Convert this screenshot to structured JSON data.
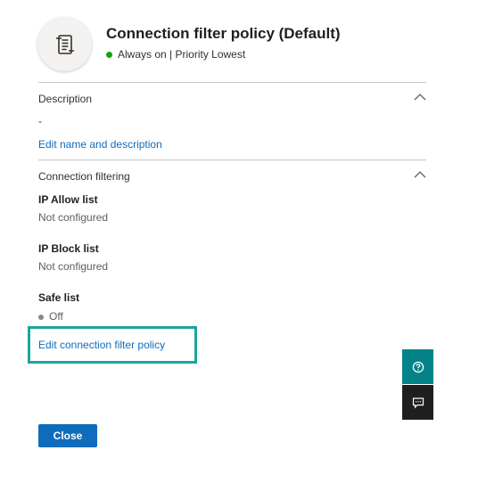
{
  "header": {
    "title": "Connection filter policy (Default)",
    "status_text": "Always on | Priority Lowest",
    "icon": "policy-scroll-icon",
    "status_color": "#13a10e"
  },
  "description": {
    "heading": "Description",
    "value": "-",
    "edit_link": "Edit name and description"
  },
  "connection_filtering": {
    "heading": "Connection filtering",
    "ip_allow_label": "IP Allow list",
    "ip_allow_value": "Not configured",
    "ip_block_label": "IP Block list",
    "ip_block_value": "Not configured",
    "safe_list_label": "Safe list",
    "safe_list_value": "Off",
    "edit_link": "Edit connection filter policy"
  },
  "side_buttons": {
    "help_icon": "help-question-icon",
    "feedback_icon": "feedback-chat-icon"
  },
  "footer": {
    "close_label": "Close"
  },
  "colors": {
    "accent": "#0f6cbd",
    "highlight_border": "#1aa69a",
    "help_bg": "#038387",
    "feedback_bg": "#1f1f1f"
  }
}
